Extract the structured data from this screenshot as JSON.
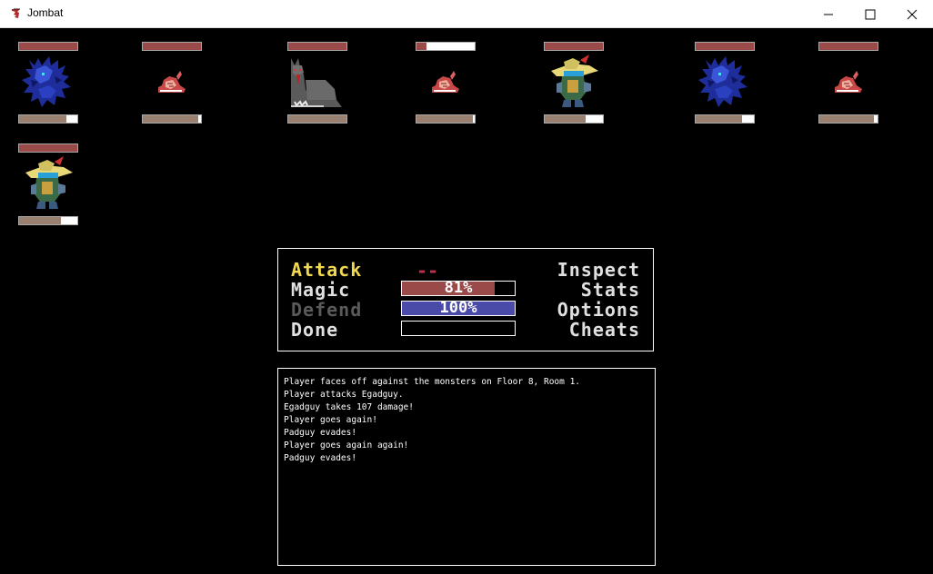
{
  "window": {
    "title": "Jombat"
  },
  "colors": {
    "hp_fill": "#9b4a4a",
    "bar_fill": "#9a8070",
    "mp_fill": "#4a4aa8",
    "menu_active": "#f0d850",
    "menu_normal": "#e0e0e0",
    "menu_disabled": "#5a5a5a",
    "target": "#c0304c"
  },
  "units": [
    {
      "name": "blue-dragon",
      "hp": 1.0,
      "bar": 0.82
    },
    {
      "name": "snail",
      "hp": 1.0,
      "bar": 0.95
    },
    {
      "name": "gray-wolf",
      "hp": 1.0,
      "bar": 1.0
    },
    {
      "name": "snail",
      "hp": 0.17,
      "bar": 0.97
    },
    {
      "name": "adventurer",
      "hp": 1.0,
      "bar": 0.7
    },
    {
      "name": "blue-dragon",
      "hp": 1.0,
      "bar": 0.8
    },
    {
      "name": "snail",
      "hp": 1.0,
      "bar": 0.93
    },
    {
      "name": "adventurer",
      "hp": 1.0,
      "bar": 0.72
    }
  ],
  "menu": {
    "left": [
      {
        "label": "Attack",
        "state": "active"
      },
      {
        "label": "Magic",
        "state": "normal"
      },
      {
        "label": "Defend",
        "state": "disabled"
      },
      {
        "label": "Done",
        "state": "normal"
      }
    ],
    "right": [
      {
        "label": "Inspect"
      },
      {
        "label": "Stats"
      },
      {
        "label": "Options"
      },
      {
        "label": "Cheats"
      }
    ],
    "target": "--",
    "gauges": [
      {
        "text": "81%",
        "value": 0.82,
        "color": "#9b4a4a"
      },
      {
        "text": "100%",
        "value": 1.0,
        "color": "#4a4aa8"
      },
      {
        "text": "",
        "value": 0.0,
        "color": "#000000"
      }
    ]
  },
  "log": {
    "lines": [
      "Player faces off against the monsters on Floor 8, Room 1.",
      "Player attacks Egadguy.",
      "Egadguy takes 107 damage!",
      "Player goes again!",
      "Padguy evades!",
      "Player goes again again!",
      "Padguy evades!"
    ]
  }
}
